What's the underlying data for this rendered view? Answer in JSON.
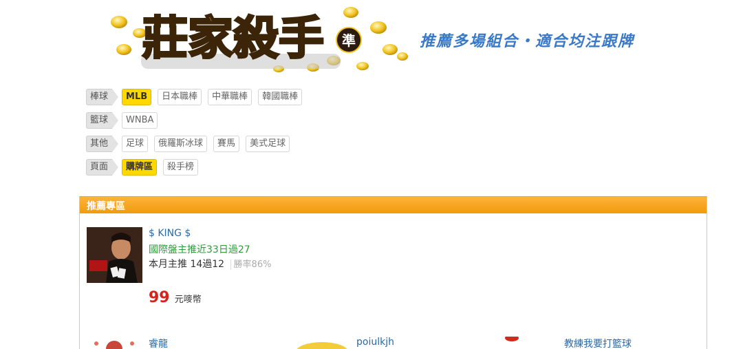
{
  "header": {
    "logo_text": "莊家殺手",
    "logo_badge": "準",
    "tagline": "推薦多場組合・適合均注跟牌"
  },
  "filters": [
    {
      "label": "棒球",
      "items": [
        {
          "label": "MLB",
          "active": true
        },
        {
          "label": "日本職棒",
          "active": false
        },
        {
          "label": "中華職棒",
          "active": false
        },
        {
          "label": "韓國職棒",
          "active": false
        }
      ]
    },
    {
      "label": "籃球",
      "items": [
        {
          "label": "WNBA",
          "active": false
        }
      ]
    },
    {
      "label": "其他",
      "items": [
        {
          "label": "足球",
          "active": false
        },
        {
          "label": "俄羅斯冰球",
          "active": false
        },
        {
          "label": "賽馬",
          "active": false
        },
        {
          "label": "美式足球",
          "active": false
        }
      ]
    },
    {
      "label": "頁面",
      "items": [
        {
          "label": "購牌區",
          "active": true
        },
        {
          "label": "殺手榜",
          "active": false
        }
      ]
    }
  ],
  "panel": {
    "title": "推薦專區",
    "featured": {
      "name": "$ KING $",
      "record": "國際盤主推近33日過27",
      "month_prefix": "本月主推",
      "month_value": "14過12",
      "win_rate": "勝率86%",
      "price": "99",
      "price_unit": "元嘜幣"
    },
    "others": [
      {
        "name": "睿龍"
      },
      {
        "name": "poiulkjh"
      },
      {
        "name": "教練我要打籃球"
      }
    ]
  },
  "colors": {
    "accent_yellow": "#ffd800",
    "panel_orange": "#f29a0f",
    "link_blue": "#2a6aa8",
    "green_text": "#2f9a3a",
    "price_red": "#d4241c",
    "tagline_blue": "#3a78c8"
  }
}
